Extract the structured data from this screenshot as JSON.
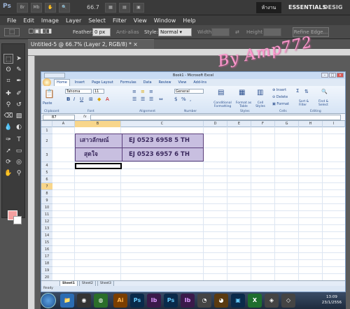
{
  "app": {
    "logo": "Ps",
    "zoom": "66.7",
    "workspace_active": "ห้างาน",
    "workspace_essentials": "ESSENTIALS",
    "workspace_design": "DESIG"
  },
  "menu": [
    "File",
    "Edit",
    "Image",
    "Layer",
    "Select",
    "Filter",
    "View",
    "Window",
    "Help"
  ],
  "options": {
    "feather_label": "Feather:",
    "feather_value": "0 px",
    "antialias_label": "Anti-alias",
    "style_label": "Style:",
    "style_value": "Normal",
    "width_label": "Width:",
    "height_label": "Height:",
    "refine_label": "Refine Edge..."
  },
  "document": {
    "tab_title": "Untitled-5 @ 66.7% (Layer 2, RGB/8) *",
    "watermark": "By Amp772"
  },
  "colors": {
    "foreground": "#f4a0a0",
    "background": "#ffffff"
  },
  "excel": {
    "title": "Book1 - Microsoft Excel",
    "tabs": [
      "Home",
      "Insert",
      "Page Layout",
      "Formulas",
      "Data",
      "Review",
      "View",
      "Add-Ins"
    ],
    "ribbon": {
      "paste": "Paste",
      "font_name": "Tahoma",
      "font_size": "11",
      "number_format": "General",
      "conditional": "Conditional Formatting",
      "format_table": "Format as Table",
      "cell_styles": "Cell Styles",
      "insert": "Insert",
      "delete": "Delete",
      "format": "Format",
      "sort": "Sort & Filter",
      "find": "Find & Select",
      "groups": [
        "Clipboard",
        "Font",
        "Alignment",
        "Number",
        "Styles",
        "Cells",
        "Editing"
      ]
    },
    "name_box": "B7",
    "fx": "fx",
    "columns": [
      "A",
      "B",
      "C",
      "D",
      "E",
      "F",
      "G",
      "H",
      "I"
    ],
    "rows": [
      "1",
      "2",
      "3",
      "4",
      "5",
      "6",
      "7",
      "8",
      "9",
      "10",
      "11",
      "12",
      "13",
      "14",
      "15",
      "16",
      "17",
      "18",
      "19",
      "20",
      "21",
      "22",
      "23",
      "24"
    ],
    "table": [
      [
        "เสาวลักษณ์",
        "EJ 0523 6958 5 TH"
      ],
      [
        "สุดใจ",
        "EJ 0523 6957 6 TH"
      ]
    ],
    "sheets": [
      "Sheet1",
      "Sheet2",
      "Sheet3"
    ],
    "status": "Ready"
  },
  "taskbar": {
    "items": [
      "Ai",
      "Ps",
      "Ib",
      "Ps",
      "Ib"
    ],
    "time": "13:09",
    "date": "23/1/2556"
  }
}
